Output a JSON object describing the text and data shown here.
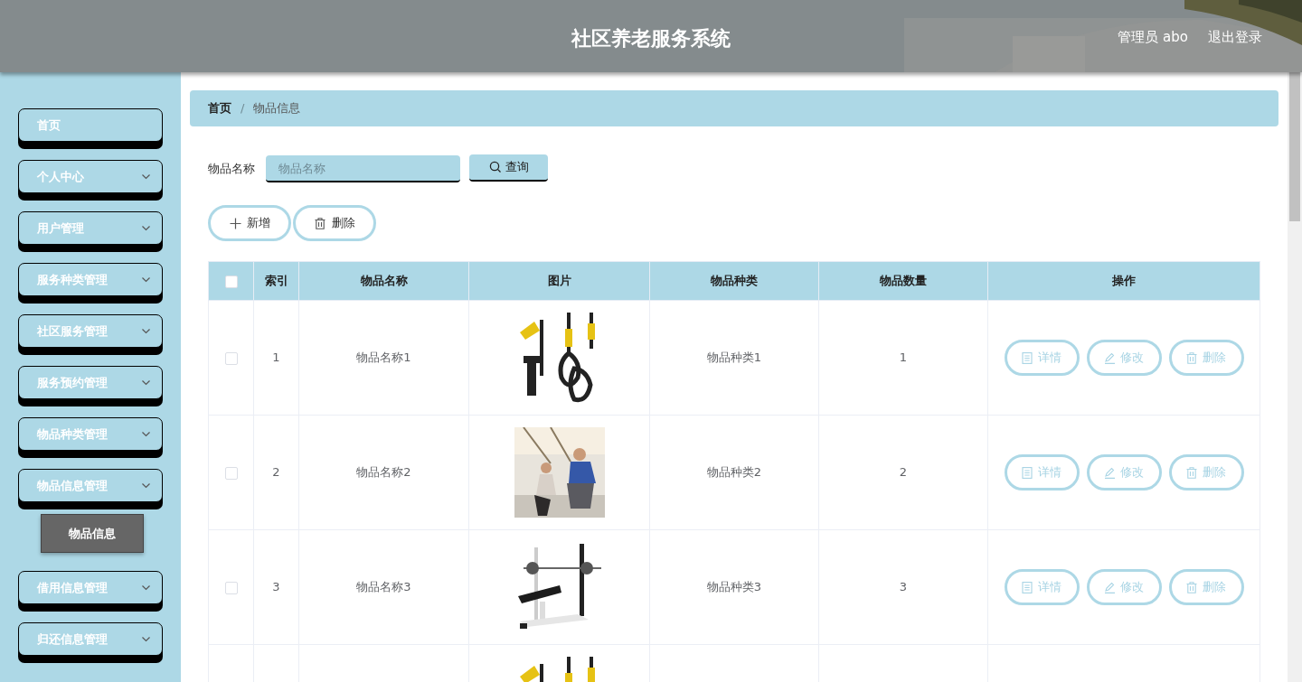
{
  "header": {
    "title": "社区养老服务系统",
    "user": "管理员 abo",
    "logout": "退出登录"
  },
  "sidebar": {
    "items": [
      {
        "label": "首页",
        "expandable": false
      },
      {
        "label": "个人中心",
        "expandable": true
      },
      {
        "label": "用户管理",
        "expandable": true
      },
      {
        "label": "服务种类管理",
        "expandable": true
      },
      {
        "label": "社区服务管理",
        "expandable": true
      },
      {
        "label": "服务预约管理",
        "expandable": true
      },
      {
        "label": "物品种类管理",
        "expandable": true
      },
      {
        "label": "物品信息管理",
        "expandable": true,
        "children": [
          {
            "label": "物品信息",
            "selected": true
          }
        ]
      },
      {
        "label": "借用信息管理",
        "expandable": true
      },
      {
        "label": "归还信息管理",
        "expandable": true
      }
    ]
  },
  "breadcrumb": [
    "首页",
    "物品信息"
  ],
  "breadcrumb_separator": "/",
  "search": {
    "label": "物品名称",
    "placeholder": "物品名称",
    "button": "查询"
  },
  "actions": [
    "新增",
    "删除"
  ],
  "table": {
    "columns": [
      "索引",
      "物品名称",
      "图片",
      "物品种类",
      "物品数量",
      "操作"
    ],
    "header_checked": false,
    "rows": [
      {
        "index": "1",
        "name": "物品名称1",
        "picture": {
          "kind": "picture"
        },
        "category": "物品种类1",
        "quantity": "1",
        "checked": false,
        "buttons": [
          "详情",
          "修改",
          "删除"
        ]
      },
      {
        "index": "2",
        "name": "物品名称2",
        "picture": {
          "kind": "picture"
        },
        "category": "物品种类2",
        "quantity": "2",
        "checked": false,
        "buttons": [
          "详情",
          "修改",
          "删除"
        ]
      },
      {
        "index": "3",
        "name": "物品名称3",
        "picture": {
          "kind": "picture"
        },
        "category": "物品种类3",
        "quantity": "3",
        "checked": false,
        "buttons": [
          "详情",
          "修改",
          "删除"
        ]
      },
      {
        "picture": {
          "kind": "picture"
        }
      }
    ]
  }
}
